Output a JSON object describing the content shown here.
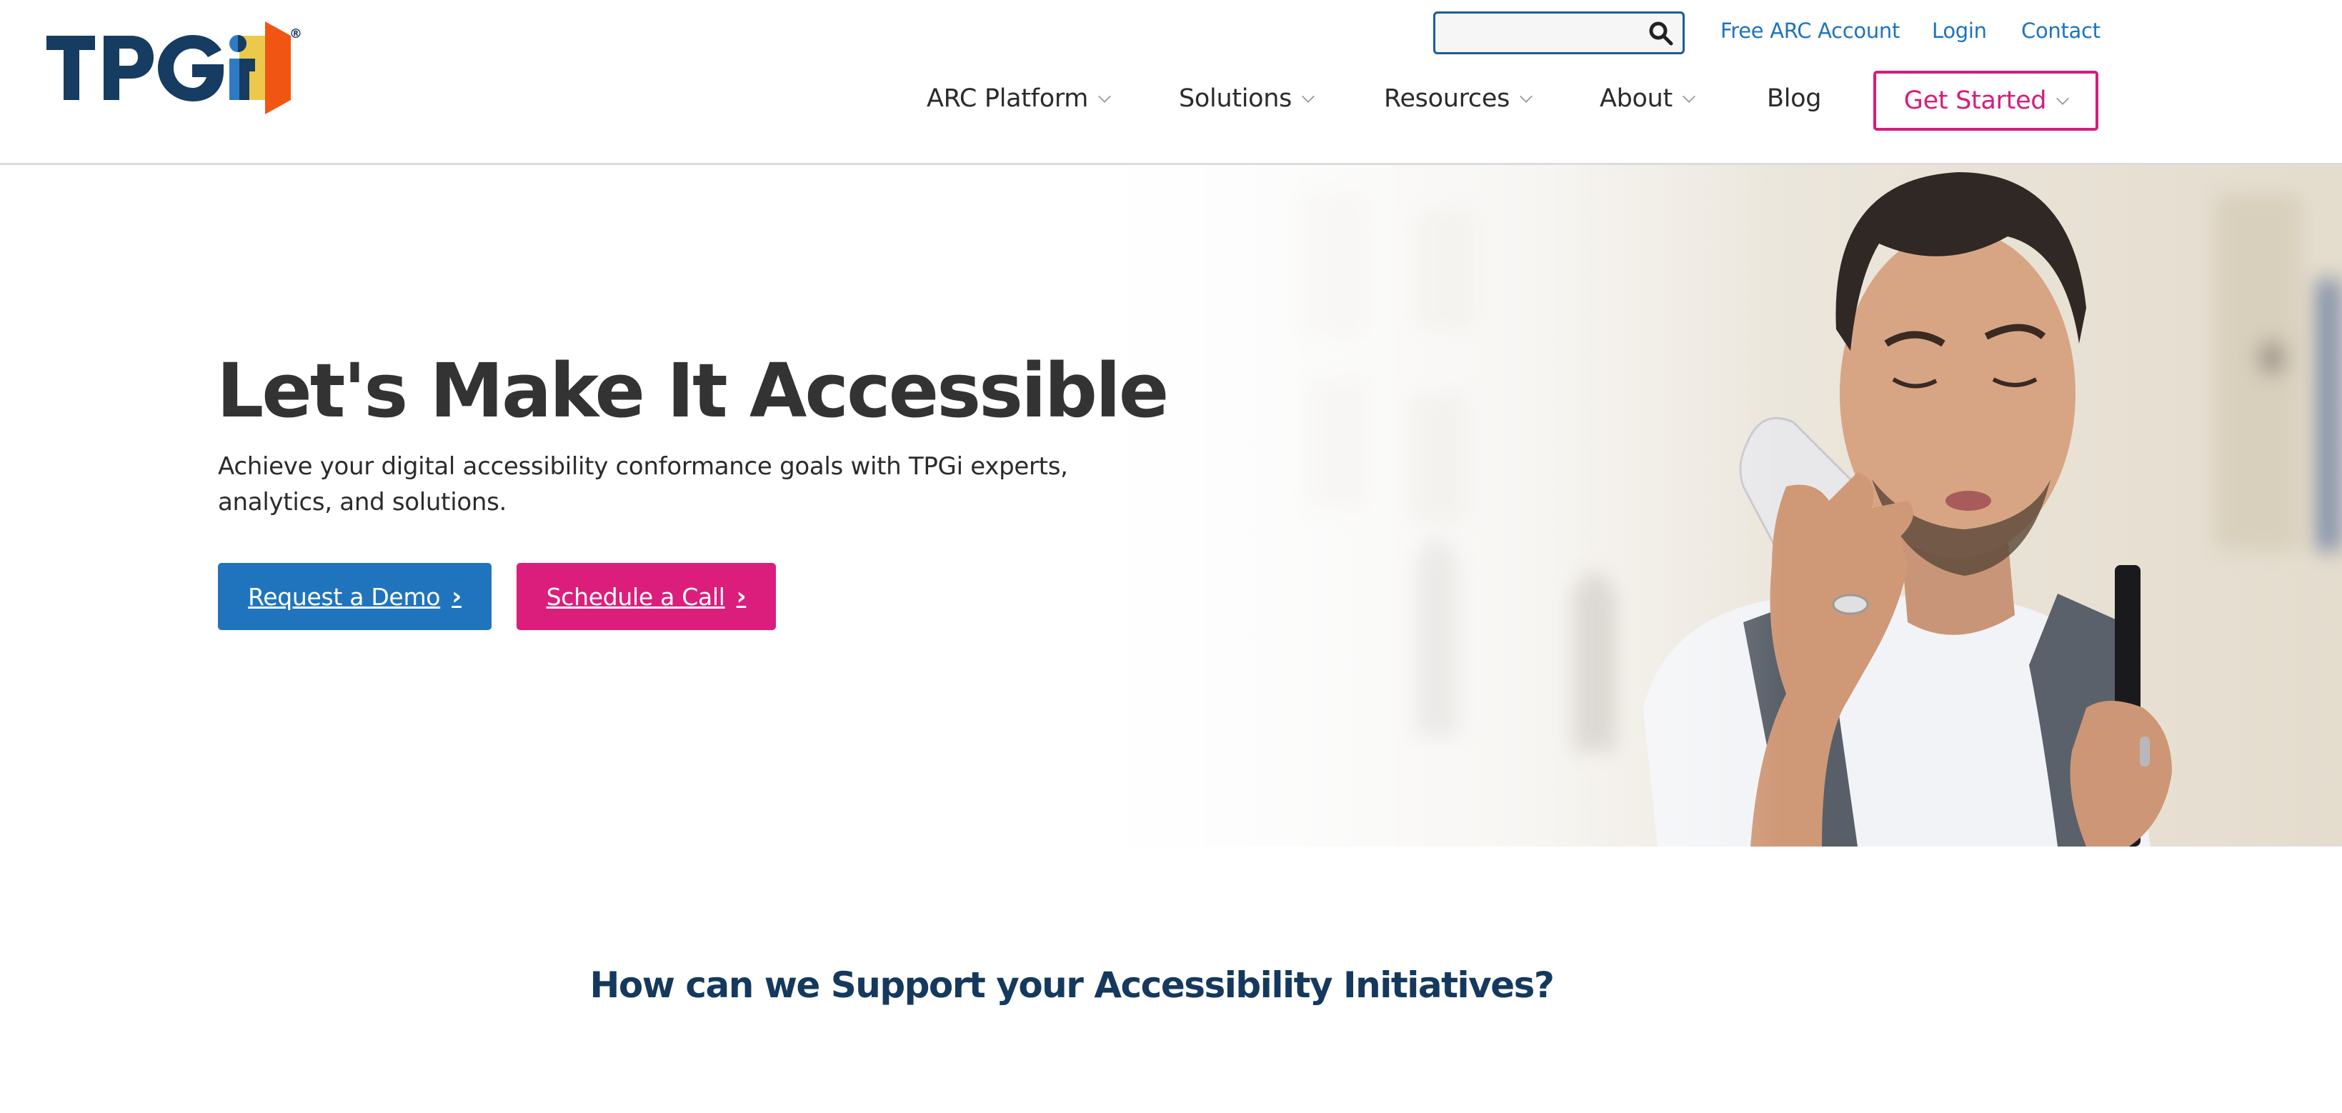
{
  "brand": {
    "name": "TPGi",
    "registered_mark": "®",
    "colors": {
      "navy": "#173c62",
      "blue": "#2074bd",
      "yellow": "#ecc94b",
      "orange": "#f05612",
      "pink": "#db1e7c"
    }
  },
  "header": {
    "search": {
      "placeholder": "",
      "value": "",
      "icon": "search-icon"
    },
    "utility_links": [
      {
        "label": "Free ARC Account"
      },
      {
        "label": "Login"
      },
      {
        "label": "Contact"
      }
    ],
    "nav": [
      {
        "label": "ARC Platform",
        "has_dropdown": true
      },
      {
        "label": "Solutions",
        "has_dropdown": true
      },
      {
        "label": "Resources",
        "has_dropdown": true
      },
      {
        "label": "About",
        "has_dropdown": true
      },
      {
        "label": "Blog",
        "has_dropdown": false
      }
    ],
    "cta": {
      "label": "Get Started",
      "has_dropdown": true
    }
  },
  "hero": {
    "title": "Let's Make It Accessible",
    "subtitle": "Achieve your digital accessibility conformance goals with TPGi experts, analytics, and solutions.",
    "buttons": [
      {
        "label": "Request a Demo",
        "icon": "chevron-right-icon",
        "color": "#2074bd"
      },
      {
        "label": "Schedule a Call",
        "icon": "chevron-right-icon",
        "color": "#db1e7c"
      }
    ],
    "image_alt": "Man with white cane speaking into a smartphone on a city street"
  },
  "section": {
    "heading": "How can we Support your Accessibility Initiatives?"
  }
}
